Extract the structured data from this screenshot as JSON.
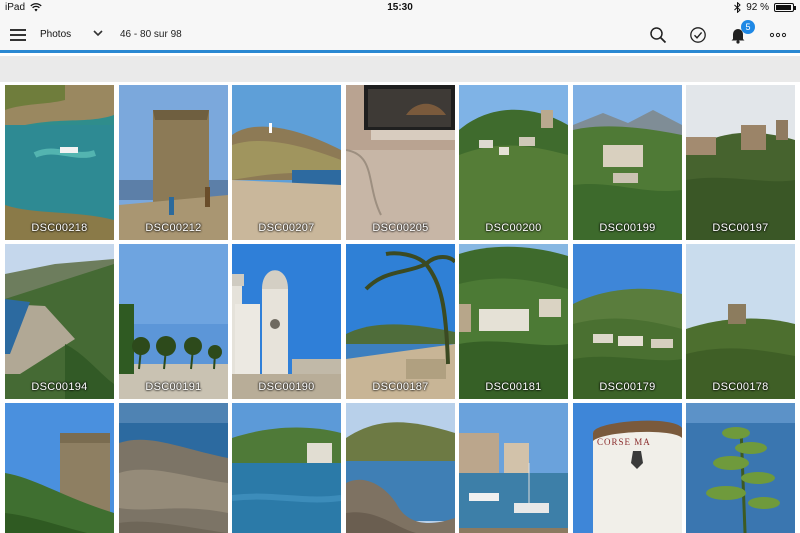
{
  "status_bar": {
    "device": "iPad",
    "time": "15:30",
    "battery": "92 %",
    "battery_level": 0.92
  },
  "nav": {
    "title": "Photos",
    "range": "46 - 80 sur 98",
    "notification_count": "5",
    "icons": [
      "menu-icon",
      "chevron-down-icon",
      "search-icon",
      "check-circle-icon",
      "bell-icon",
      "more-icon"
    ],
    "accent_color": "#2a88d2"
  },
  "photos": [
    {
      "caption": "DSC00218",
      "scene": "cove"
    },
    {
      "caption": "DSC00212",
      "scene": "tower"
    },
    {
      "caption": "DSC00207",
      "scene": "rocky-coast"
    },
    {
      "caption": "DSC00205",
      "scene": "tv-room"
    },
    {
      "caption": "DSC00200",
      "scene": "village-hill"
    },
    {
      "caption": "DSC00199",
      "scene": "village-mountain"
    },
    {
      "caption": "DSC00197",
      "scene": "hill-town"
    },
    {
      "caption": "DSC00194",
      "scene": "beach-coast"
    },
    {
      "caption": "DSC00191",
      "scene": "palms-towers"
    },
    {
      "caption": "DSC00190",
      "scene": "bell-tower"
    },
    {
      "caption": "DSC00187",
      "scene": "palm-bay"
    },
    {
      "caption": "DSC00181",
      "scene": "village-green"
    },
    {
      "caption": "DSC00179",
      "scene": "hills-houses"
    },
    {
      "caption": "DSC00178",
      "scene": "hill-tower"
    },
    {
      "caption": "",
      "scene": "round-tower"
    },
    {
      "caption": "",
      "scene": "rocks-sea"
    },
    {
      "caption": "",
      "scene": "bay-village"
    },
    {
      "caption": "",
      "scene": "rocky-shore"
    },
    {
      "caption": "",
      "scene": "harbor"
    },
    {
      "caption": "CORSE MA",
      "scene": "lighthouse-sign"
    },
    {
      "caption": "",
      "scene": "agave-sea"
    }
  ]
}
